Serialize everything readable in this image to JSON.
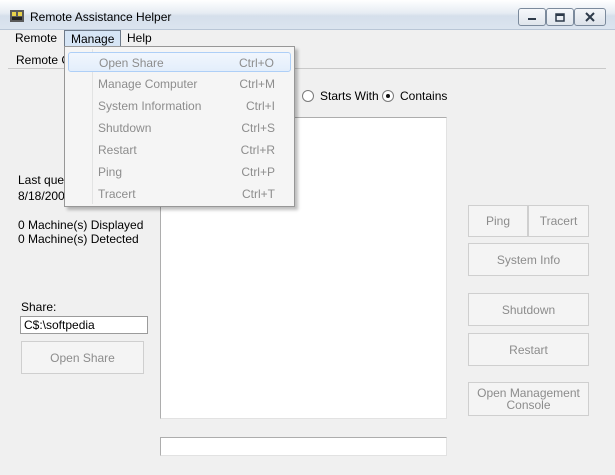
{
  "window": {
    "title": "Remote Assistance Helper"
  },
  "menubar": {
    "items": [
      "Remote",
      "Manage",
      "Help"
    ]
  },
  "manage_menu": {
    "items": [
      {
        "label": "Open Share",
        "shortcut": "Ctrl+O"
      },
      {
        "label": "Manage Computer",
        "shortcut": "Ctrl+M"
      },
      {
        "label": "System Information",
        "shortcut": "Ctrl+I"
      },
      {
        "label": "Shutdown",
        "shortcut": "Ctrl+S"
      },
      {
        "label": "Restart",
        "shortcut": "Ctrl+R"
      },
      {
        "label": "Ping",
        "shortcut": "Ctrl+P"
      },
      {
        "label": "Tracert",
        "shortcut": "Ctrl+T"
      }
    ]
  },
  "main": {
    "remote_label": "Remote C",
    "search_mode": {
      "options": [
        "Starts With",
        "Contains"
      ],
      "selected": "Contains"
    },
    "last_query_label": "Last quer",
    "last_query_value": "8/18/200",
    "machines_displayed": "0 Machine(s) Displayed",
    "machines_detected": "0 Machine(s) Detected",
    "share_label": "Share:",
    "share_value": "C$:\\softpedia",
    "open_share_button": "Open Share",
    "status_text": ""
  },
  "actions": {
    "ping": "Ping",
    "tracert": "Tracert",
    "system_info": "System Info",
    "shutdown": "Shutdown",
    "restart": "Restart",
    "open_mgmt_console": "Open Management Console"
  }
}
